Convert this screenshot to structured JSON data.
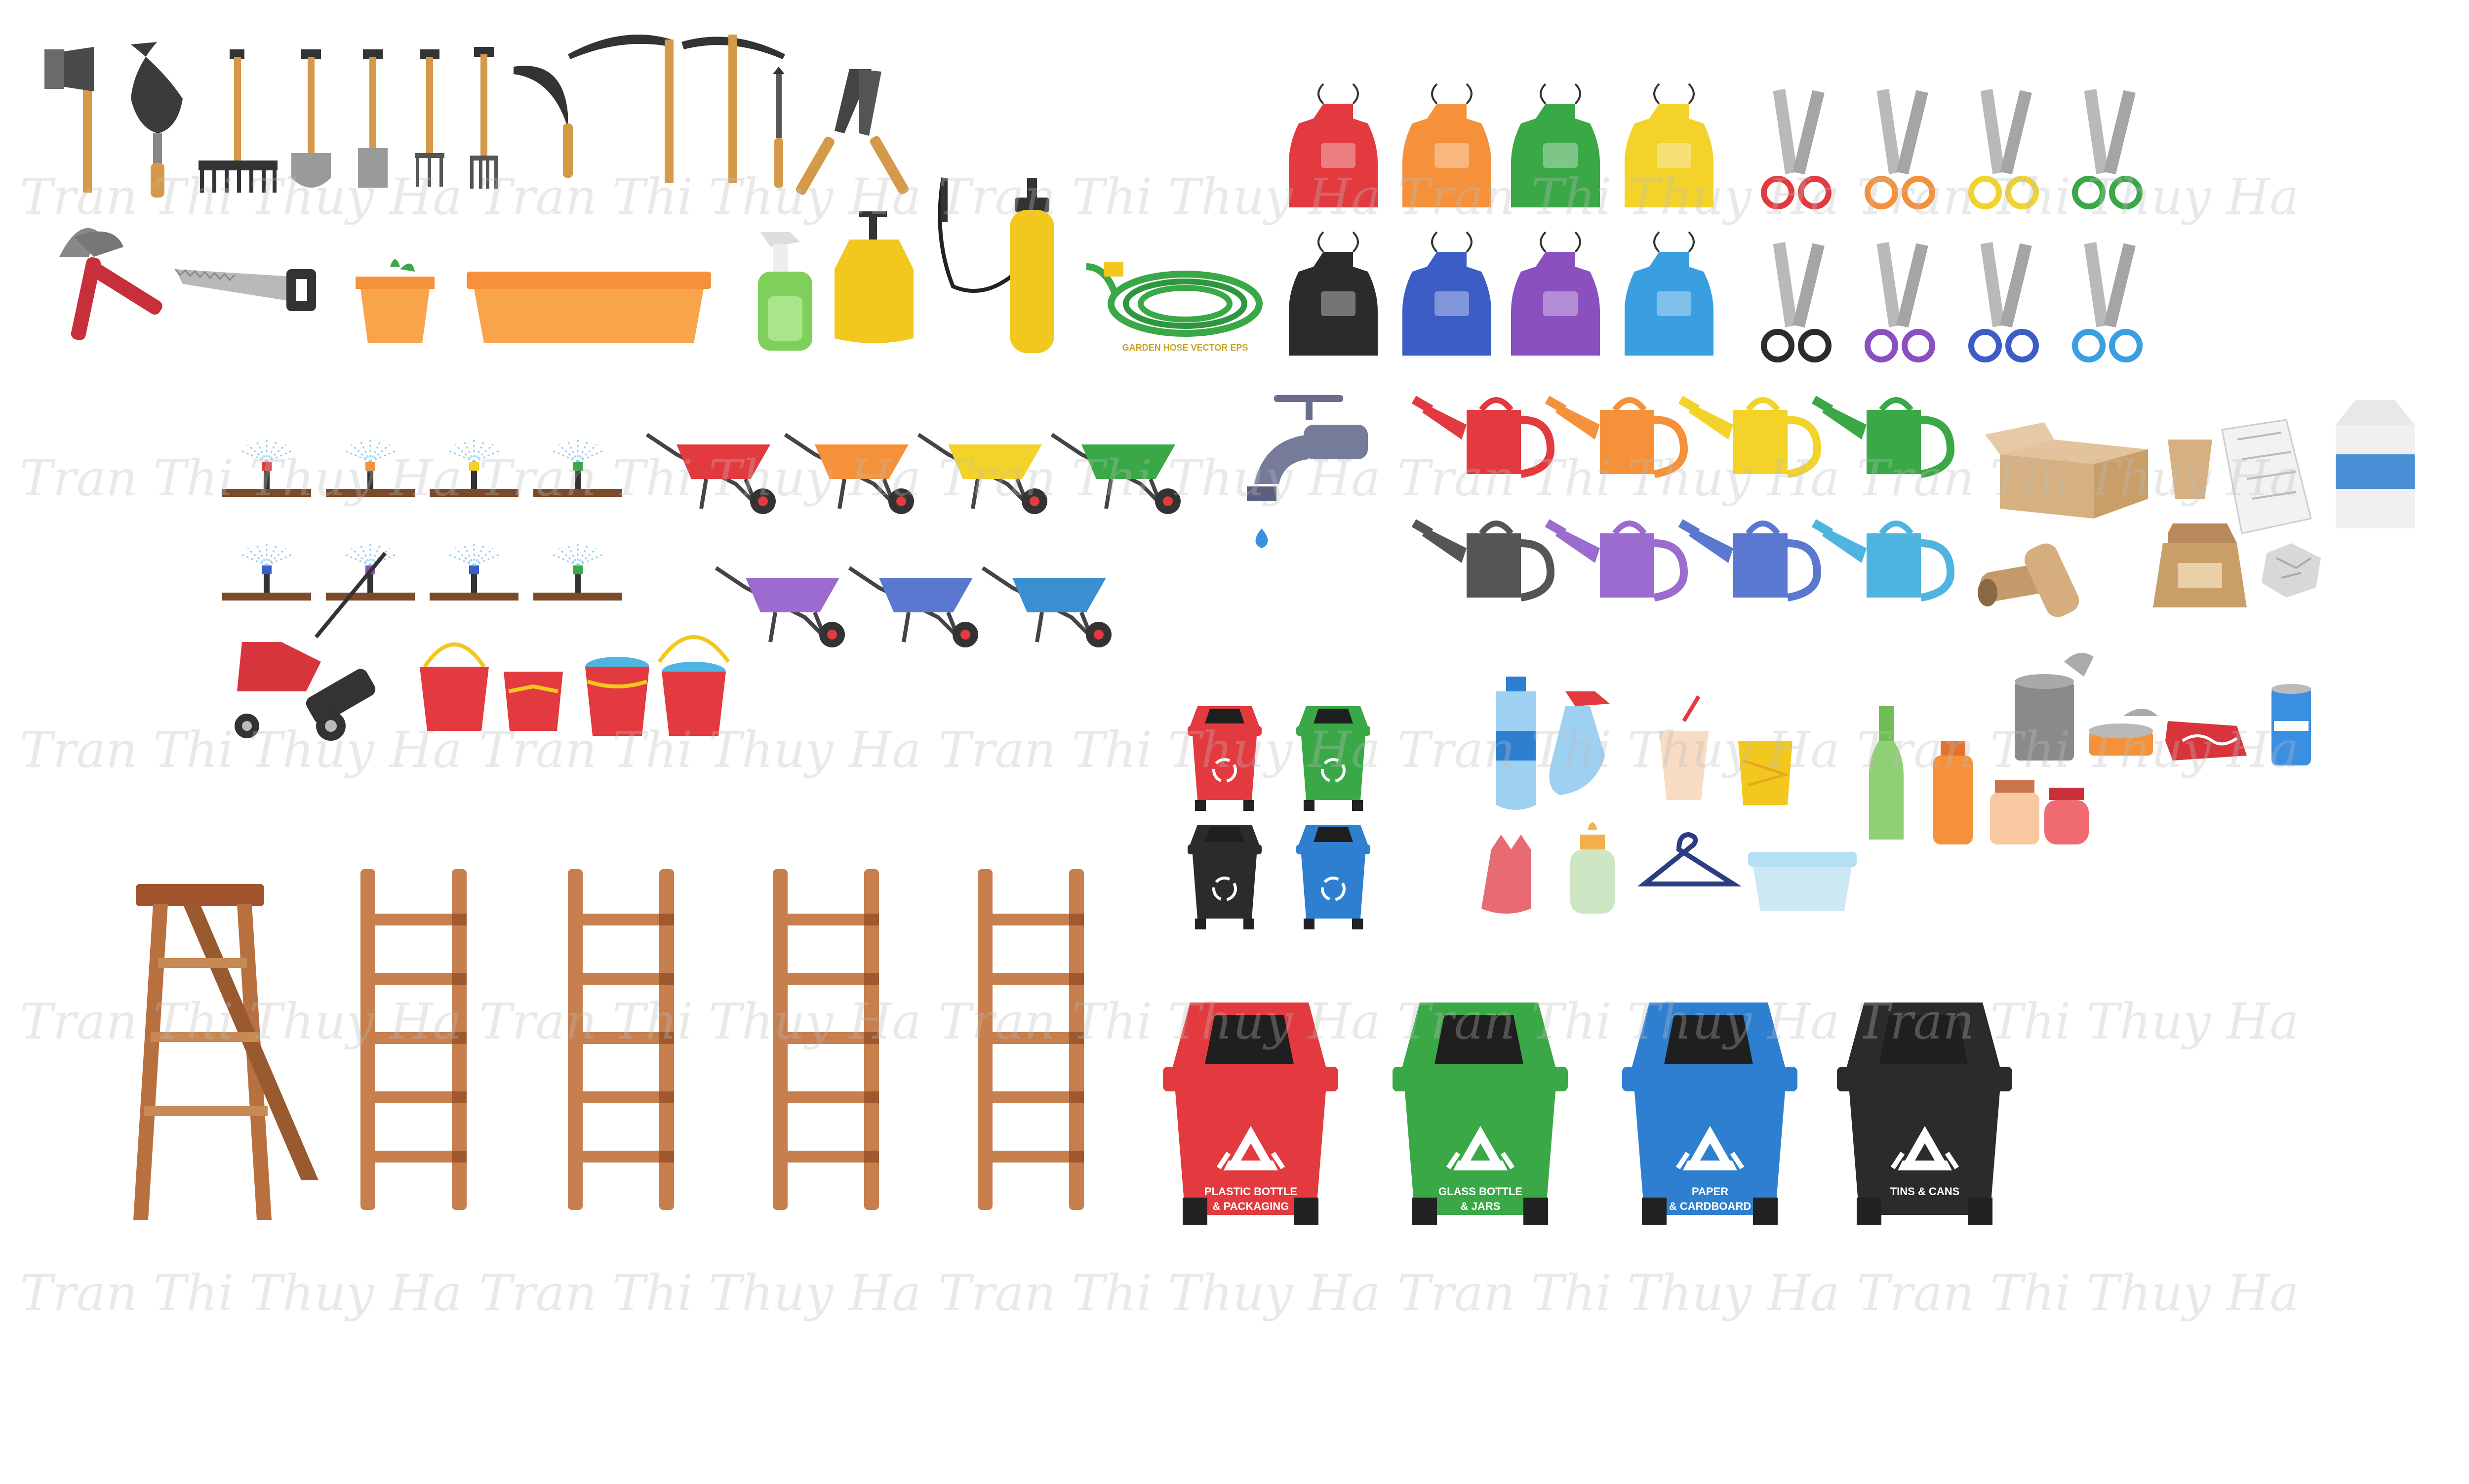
{
  "watermark": {
    "text": "Tran Thi Thuy Ha"
  },
  "hose": {
    "label": "GARDEN HOSE VECTOR EPS"
  },
  "small_bins": [
    {
      "color": "#e23a3f"
    },
    {
      "color": "#3aa847"
    },
    {
      "color": "#2b2b2b"
    },
    {
      "color": "#2f7fd0"
    }
  ],
  "big_bins": [
    {
      "color": "#e23a3f",
      "line1": "PLASTIC BOTTLE",
      "line2": "& PACKAGING"
    },
    {
      "color": "#3aa847",
      "line1": "GLASS BOTTLE",
      "line2": "& JARS"
    },
    {
      "color": "#2f7fd0",
      "line1": "PAPER",
      "line2": "& CARDBOARD"
    },
    {
      "color": "#2b2b2b",
      "line1": "TINS & CANS",
      "line2": ""
    }
  ],
  "aprons": [
    "#e23a3f",
    "#f5913a",
    "#3aa847",
    "#f3d22a",
    "#2b2b2b",
    "#3c5cc6",
    "#8a50c0",
    "#3a9fe0"
  ],
  "scissors": [
    "#e23a3f",
    "#f5913a",
    "#f3d22a",
    "#3aa847",
    "#2b2b2b",
    "#8a50c0",
    "#3c5cc6",
    "#3a9fe0"
  ],
  "cans": [
    "#e23a3f",
    "#f5913a",
    "#f3d22a",
    "#3aa847",
    "#555555",
    "#9b6bd0",
    "#5a78cf",
    "#4fb4e0"
  ],
  "wheelbarrows": [
    "#e23a3f",
    "#f5913a",
    "#f3d22a",
    "#3aa847",
    "#9b6bd0",
    "#5a78cf",
    "#3a8fd0"
  ],
  "sprinklers": [
    "#e23a3f",
    "#f5913a",
    "#f3d22a",
    "#3aa847",
    "#3c5cc6",
    "#8a50c0",
    "#3c5cc6",
    "#3aa847"
  ]
}
